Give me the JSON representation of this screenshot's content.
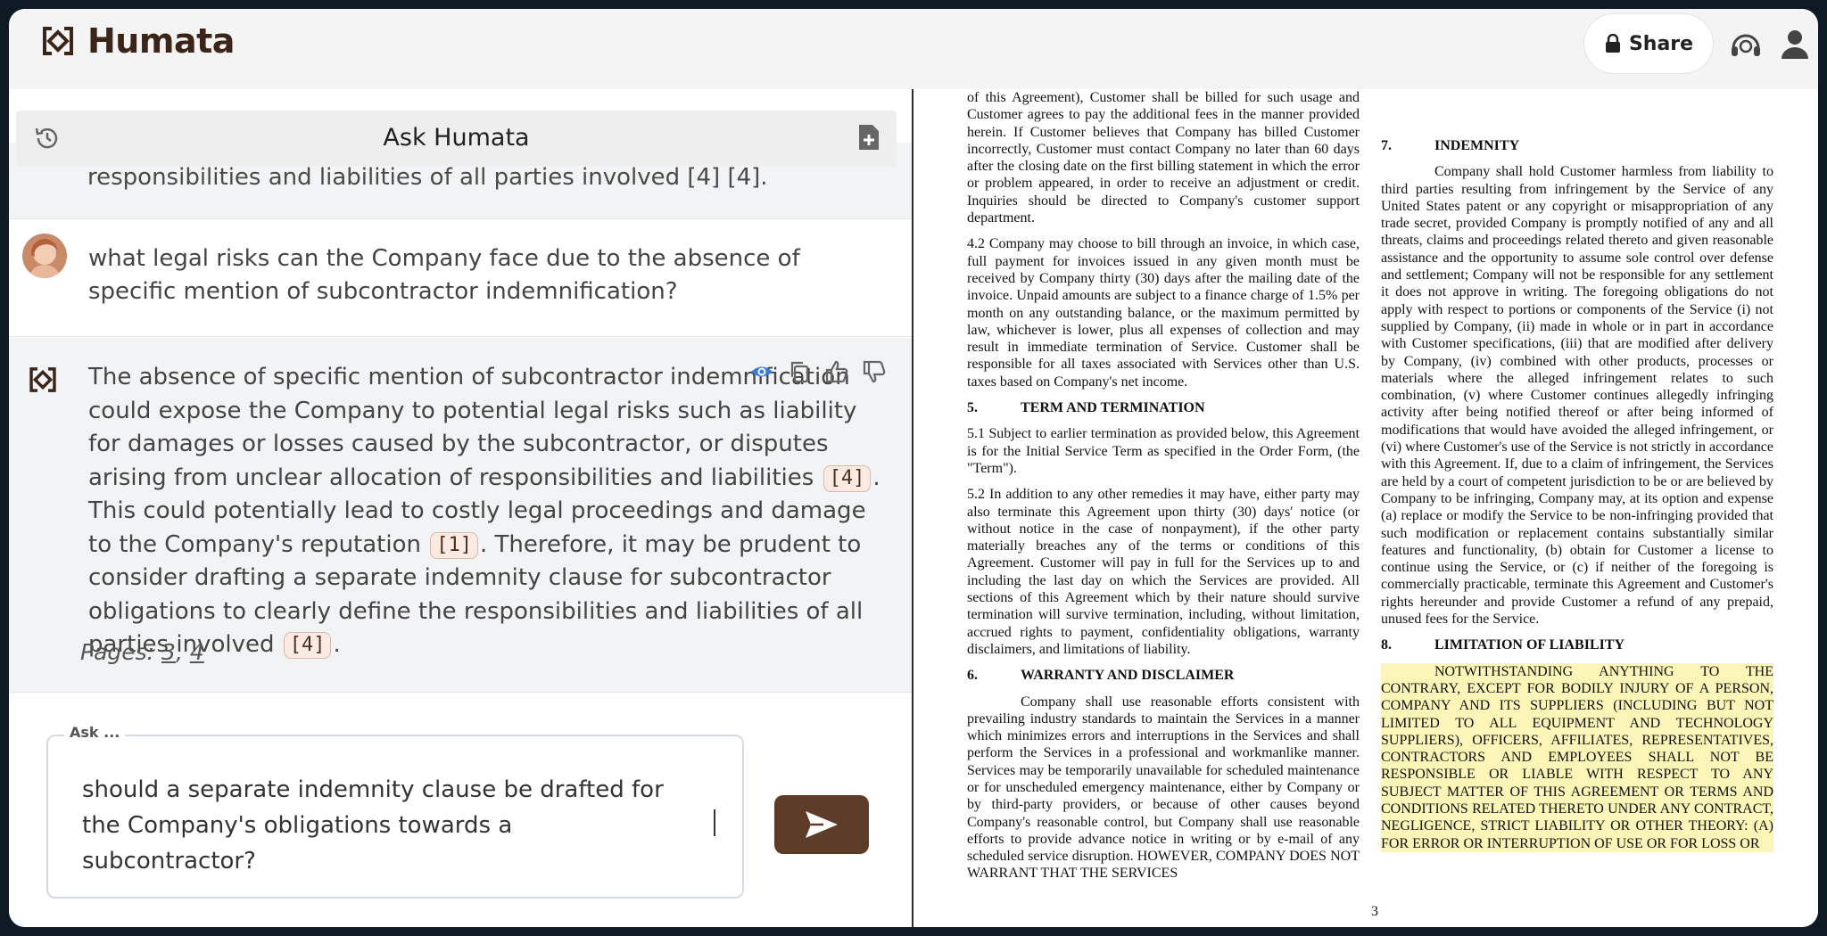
{
  "app": {
    "name": "Humata"
  },
  "header": {
    "share_label": "Share"
  },
  "chat": {
    "title": "Ask Humata",
    "clipped_text": "responsibilities and liabilities of all parties involved [4] [4].",
    "user_question": "what legal risks can the Company face due to the absence of specific mention of subcontractor indemnification?",
    "answer": {
      "part1": "The absence of specific mention of subcontractor indemnification could expose the Company to potential legal risks such as liability for damages or losses caused by the subcontractor, or disputes arising from unclear allocation of responsibilities and liabilities",
      "cite1": "[4]",
      "part2": ". This could potentially lead to costly legal proceedings and damage to the Company's reputation",
      "cite2": "[1]",
      "part3": ". Therefore, it may be prudent to consider drafting a separate indemnity clause for subcontractor obligations to clearly define the responsibilities and liabilities of all parties involved",
      "cite3": "[4]",
      "part4": "."
    },
    "pages_label": "Pages:",
    "pages": [
      "3",
      "4"
    ],
    "pages_sep": ", "
  },
  "ask": {
    "label": "Ask ...",
    "value": "should a separate indemnity clause be drafted for the Company's obligations towards a subcontractor?"
  },
  "document": {
    "col1": {
      "p0": "of this Agreement), Customer shall be billed for such usage and Customer agrees to pay the additional fees in the manner provided herein. If Customer believes that Company has billed Customer incorrectly, Customer must contact Company no later than 60 days after the closing date on the first billing statement in which the error or problem appeared, in order to receive an adjustment or credit. Inquiries should be directed to Company's customer support department.",
      "p42": "4.2        Company may choose to bill through an invoice, in which case, full payment for invoices issued in any given month must be received by Company thirty (30) days after the mailing date of the invoice. Unpaid amounts are subject to a finance charge of 1.5% per month on any outstanding balance, or the maximum permitted by law, whichever is lower, plus all expenses of collection and may result in immediate termination of Service. Customer shall be responsible for all taxes associated with Services other than U.S. taxes based on Company's net income.",
      "s5_num": "5.",
      "s5_title": "TERM AND TERMINATION",
      "p51": "5.1        Subject to earlier termination as provided below, this Agreement is for the Initial Service Term as specified in the Order Form, (the \"Term\").",
      "p52": "5.2        In addition to any other remedies it may have, either party may also terminate this Agreement upon thirty (30) days' notice (or without notice in the case of nonpayment), if the other party materially breaches any of the terms or conditions of this Agreement. Customer will pay in full for the Services up to and including the last day on which the Services are provided. All sections of this Agreement which by their nature should survive termination will survive termination, including, without limitation, accrued rights to payment, confidentiality obligations, warranty disclaimers, and limitations of liability.",
      "s6_num": "6.",
      "s6_title": "WARRANTY AND DISCLAIMER",
      "p6": "Company shall use reasonable efforts consistent with prevailing industry standards to maintain the Services in a manner which minimizes errors and interruptions in the Services and shall perform the Services in a professional and workmanlike manner. Services may be temporarily unavailable for scheduled maintenance or for unscheduled emergency maintenance, either by Company or by third-party providers, or because of other causes beyond Company's reasonable control, but Company shall use reasonable efforts to provide advance notice in writing or by e-mail of any scheduled service disruption. HOWEVER, COMPANY DOES NOT WARRANT THAT THE SERVICES"
    },
    "col2": {
      "s7_num": "7.",
      "s7_title": "INDEMNITY",
      "p7": "Company shall hold Customer harmless from liability to third parties resulting from infringement by the Service of any United States patent or any copyright or misappropriation of any trade secret, provided Company is promptly notified of any and all threats, claims and proceedings related thereto and given reasonable assistance and the opportunity to assume sole control over defense and settlement; Company will not be responsible for any settlement it does not approve in writing. The foregoing obligations do not apply with respect to portions or components of the Service (i) not supplied by Company, (ii) made in whole or in part in accordance with Customer specifications, (iii) that are modified after delivery by Company, (iv) combined with other products, processes or materials where the alleged infringement relates to such combination, (v) where Customer continues allegedly infringing activity after being notified thereof or after being informed of modifications that would have avoided the alleged infringement, or (vi) where Customer's use of the Service is not strictly in accordance with this Agreement. If, due to a claim of infringement, the Services are held by a court of competent jurisdiction to be or are believed by Company to be infringing, Company may, at its option and expense (a) replace or modify the Service to be non-infringing provided that such modification or replacement contains substantially similar features and functionality, (b) obtain for Customer a license to continue using the Service, or (c) if neither of the foregoing is commercially practicable, terminate this Agreement and Customer's rights hereunder and provide Customer a refund of any prepaid, unused fees for the Service.",
      "s8_num": "8.",
      "s8_title": "LIMITATION OF LIABILITY",
      "p8": "NOTWITHSTANDING ANYTHING TO THE CONTRARY, EXCEPT FOR BODILY INJURY OF A PERSON, COMPANY AND ITS SUPPLIERS (INCLUDING BUT NOT LIMITED TO ALL EQUIPMENT AND TECHNOLOGY SUPPLIERS), OFFICERS, AFFILIATES, REPRESENTATIVES, CONTRACTORS AND EMPLOYEES SHALL NOT BE RESPONSIBLE OR LIABLE WITH RESPECT TO ANY SUBJECT MATTER OF THIS AGREEMENT OR TERMS AND CONDITIONS RELATED THERETO UNDER ANY CONTRACT, NEGLIGENCE, STRICT LIABILITY OR OTHER THEORY: (A) FOR ERROR OR INTERRUPTION OF USE OR FOR LOSS OR"
    },
    "page_number": "3"
  },
  "icons": {
    "logo": "humata-logo-icon",
    "share": "lock-icon",
    "support": "headset-icon",
    "user": "user-icon",
    "history": "history-icon",
    "new_doc": "new-document-icon",
    "show": "eye-icon",
    "copy": "copy-icon",
    "like": "thumbs-up-icon",
    "dislike": "thumbs-down-icon",
    "send": "send-icon"
  },
  "colors": {
    "brand": "#5e3c2a",
    "logo_text": "#3b2418",
    "citation_bg": "#fbeae2",
    "highlight": "#fbf6b8",
    "eye_icon": "#3b7bd8"
  }
}
